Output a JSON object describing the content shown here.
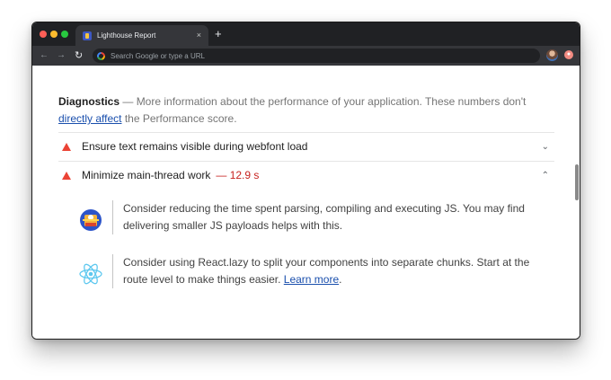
{
  "browser": {
    "tab_title": "Lighthouse Report",
    "tab_close": "×",
    "new_tab": "+",
    "back": "←",
    "forward": "→",
    "reload": "↻",
    "omnibox_placeholder": "Search Google or type a URL"
  },
  "diagnostics": {
    "title": "Diagnostics",
    "dash": " — ",
    "desc_before": "More information about the performance of your application. These numbers don't ",
    "link": "directly affect",
    "desc_after": " the Performance score."
  },
  "audits": [
    {
      "title": "Ensure text remains visible during webfont load",
      "value": "",
      "chevron": "⌄"
    },
    {
      "title": "Minimize main-thread work",
      "value": "— 12.9 s",
      "chevron": "⌃"
    }
  ],
  "tips": [
    {
      "icon": "webpack-icon",
      "text": "Consider reducing the time spent parsing, compiling and executing JS. You may find delivering smaller JS payloads helps with this."
    },
    {
      "icon": "react-icon",
      "text_before": "Consider using React.lazy to split your components into separate chunks. Start at the route level to make things easier. ",
      "link": "Learn more",
      "text_after": "."
    }
  ],
  "colors": {
    "fail": "#eb4335",
    "value_red": "#c7221f",
    "link_blue": "#1a4fad",
    "tab_bg": "#35363a",
    "titlebar_bg": "#202124"
  }
}
